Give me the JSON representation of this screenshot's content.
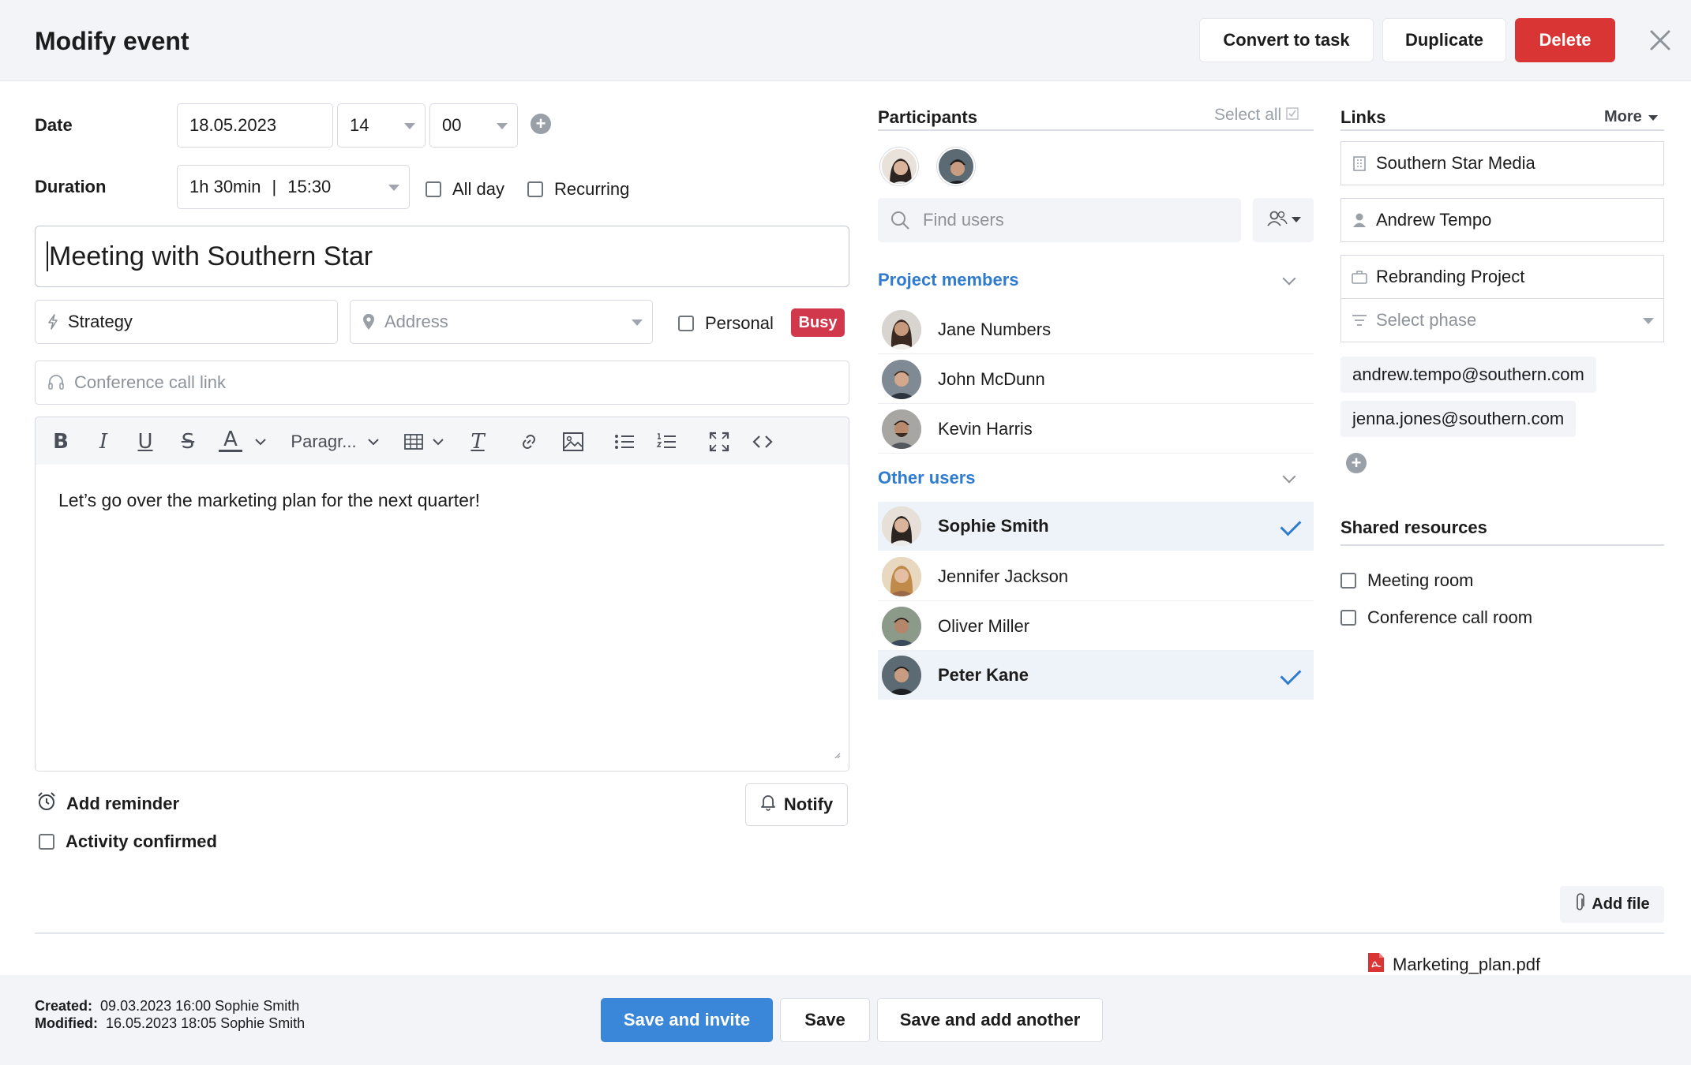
{
  "header": {
    "title": "Modify event",
    "convert_label": "Convert to task",
    "duplicate_label": "Duplicate",
    "delete_label": "Delete"
  },
  "form": {
    "date_label": "Date",
    "date_value": "18.05.2023",
    "hour_value": "14",
    "minute_value": "00",
    "duration_label": "Duration",
    "duration_value": "1h 30min",
    "end_time": "15:30",
    "all_day_label": "All day",
    "recurring_label": "Recurring",
    "event_title": "Meeting with Southern Star",
    "category_value": "Strategy",
    "address_placeholder": "Address",
    "personal_label": "Personal",
    "status_badge": "Busy",
    "conference_placeholder": "Conference call link",
    "paragraph_label": "Paragr...",
    "description": "Let’s go over the marketing plan for the next quarter!",
    "add_reminder_label": "Add reminder",
    "notify_label": "Notify",
    "activity_confirmed_label": "Activity confirmed"
  },
  "participants": {
    "title": "Participants",
    "select_all_label": "Select all",
    "find_placeholder": "Find users",
    "project_members_label": "Project members",
    "project_members": [
      {
        "name": "Jane Numbers",
        "selected": false
      },
      {
        "name": "John McDunn",
        "selected": false
      },
      {
        "name": "Kevin Harris",
        "selected": false
      }
    ],
    "other_users_label": "Other users",
    "other_users": [
      {
        "name": "Sophie Smith",
        "selected": true
      },
      {
        "name": "Jennifer Jackson",
        "selected": false
      },
      {
        "name": "Oliver Miller",
        "selected": false
      },
      {
        "name": "Peter Kane",
        "selected": true
      }
    ]
  },
  "links": {
    "title": "Links",
    "more_label": "More",
    "company": "Southern Star Media",
    "contact": "Andrew Tempo",
    "project": "Rebranding Project",
    "phase_placeholder": "Select phase",
    "emails": [
      "andrew.tempo@southern.com",
      "jenna.jones@southern.com"
    ]
  },
  "resources": {
    "title": "Shared resources",
    "items": [
      "Meeting room",
      "Conference call room"
    ]
  },
  "attachments": {
    "add_file_label": "Add file",
    "files": [
      "Marketing_plan.pdf"
    ]
  },
  "footer": {
    "created_label": "Created:",
    "created_value": "09.03.2023 16:00 Sophie Smith",
    "modified_label": "Modified:",
    "modified_value": "16.05.2023 18:05 Sophie Smith",
    "save_invite_label": "Save and invite",
    "save_label": "Save",
    "save_add_label": "Save and add another"
  },
  "colors": {
    "accent": "#3a86d8",
    "danger": "#d93535",
    "link_blue": "#2f7bd0",
    "badge_busy": "#d2384c"
  }
}
